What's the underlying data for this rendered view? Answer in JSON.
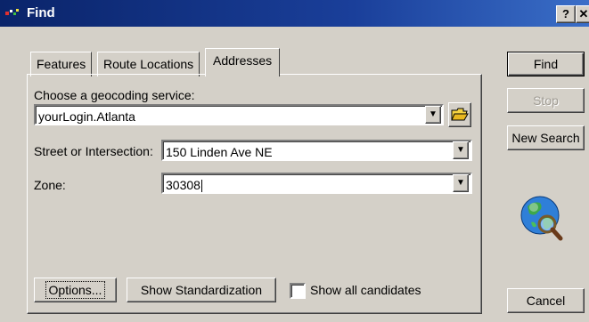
{
  "window": {
    "title": "Find",
    "help_button": "?",
    "close_button": "✕"
  },
  "tabs": [
    {
      "label": "Features"
    },
    {
      "label": "Route Locations"
    },
    {
      "label": "Addresses"
    }
  ],
  "form": {
    "service_label": "Choose a geocoding service:",
    "service_value": "yourLogin.Atlanta",
    "street_label": "Street or Intersection:",
    "street_value": "150 Linden Ave NE",
    "zone_label": "Zone:",
    "zone_value": "30308"
  },
  "buttons": {
    "options": "Options...",
    "show_standardization": "Show Standardization",
    "show_all_candidates": "Show all candidates",
    "find": "Find",
    "stop": "Stop",
    "new_search": "New Search",
    "cancel": "Cancel"
  },
  "icons": {
    "folder": "open-folder-icon",
    "globe": "globe-magnifier-icon",
    "dropdown": "dropdown-arrow-icon"
  },
  "colors": {
    "titlebar": "#0a246a",
    "face": "#d4d0c8"
  }
}
